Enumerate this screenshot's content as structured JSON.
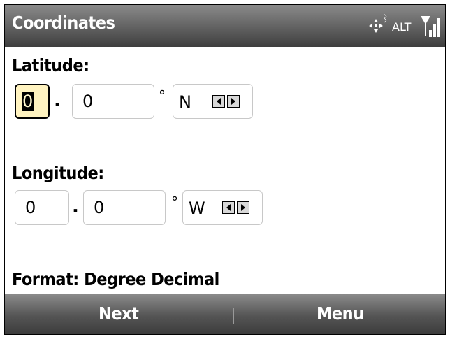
{
  "titlebar": {
    "title": "Coordinates",
    "status": {
      "network": "ALT",
      "gps_icon": "gps-icon",
      "bluetooth_icon": "bluetooth-icon",
      "signal_icon": "signal-icon"
    }
  },
  "latitude": {
    "label": "Latitude:",
    "degrees": "0",
    "separator": ".",
    "decimal": "0",
    "degree_symbol": "°",
    "direction": "N"
  },
  "longitude": {
    "label": "Longitude:",
    "degrees": "0",
    "separator": ".",
    "decimal": "0",
    "degree_symbol": "°",
    "direction": "W"
  },
  "format_label": "Format: Degree Decimal",
  "softkeys": {
    "left": "Next",
    "right": "Menu"
  },
  "colors": {
    "focus_fill": "#fff3c0",
    "bar_dark": "#3e3e3e",
    "bar_light": "#8a8a8a"
  }
}
